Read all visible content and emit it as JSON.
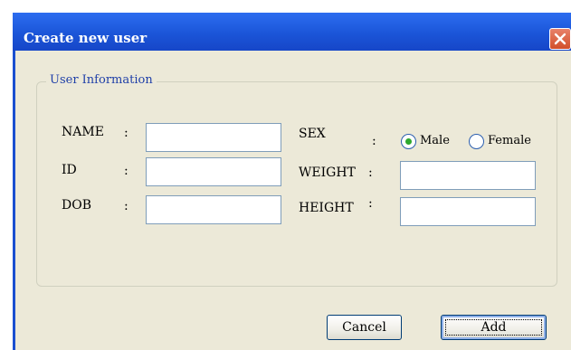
{
  "window": {
    "title": "Create new user"
  },
  "group": {
    "legend": "User Information"
  },
  "fields": {
    "name_label": "NAME",
    "id_label": "ID",
    "dob_label": "DOB",
    "sex_label": "SEX",
    "weight_label": "WEIGHT",
    "height_label": "HEIGHT",
    "colon": ":",
    "name_value": "",
    "id_value": "",
    "dob_value": "",
    "weight_value": "",
    "height_value": ""
  },
  "sex": {
    "options": [
      "Male",
      "Female"
    ],
    "selected": "Male"
  },
  "buttons": {
    "cancel": "Cancel",
    "add": "Add"
  },
  "icons": {
    "close": "close-icon"
  },
  "colors": {
    "titlebar": "#1b55d8",
    "close_button": "#d24f2a",
    "client_bg": "#ece9d8",
    "radio_dot": "#2ea82e",
    "legend_text": "#1f3fa8"
  }
}
